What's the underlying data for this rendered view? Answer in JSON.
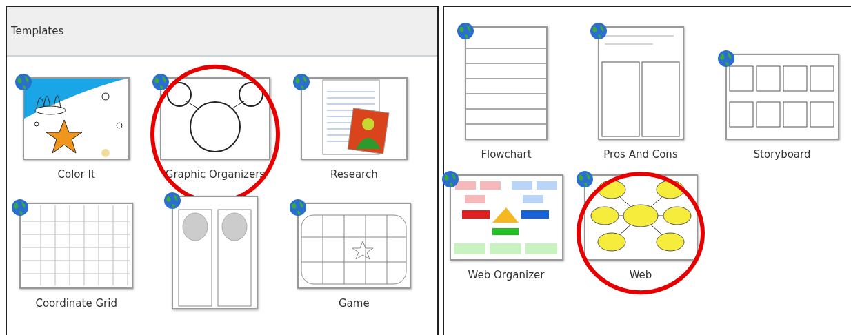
{
  "left_panel": {
    "header": "Templates",
    "templates": [
      {
        "kind": "coloring",
        "label": "Color It",
        "circled": false
      },
      {
        "kind": "circles",
        "label": "Graphic Organizers",
        "circled": true
      },
      {
        "kind": "research",
        "label": "Research",
        "circled": false
      },
      {
        "kind": "grid",
        "label": "Coordinate Grid",
        "circled": false
      },
      {
        "kind": "columns",
        "circled": false
      },
      {
        "kind": "board",
        "label": "Game",
        "circled": false
      }
    ]
  },
  "right_panel": {
    "templates": [
      {
        "kind": "flowchart",
        "label": "Flowchart",
        "circled": false
      },
      {
        "kind": "pros-cons",
        "label": "Pros And Cons",
        "circled": false
      },
      {
        "kind": "storyboard",
        "label": "Storyboard",
        "circled": false
      },
      {
        "kind": "web-organizer",
        "label": "Web Organizer",
        "circled": false
      },
      {
        "kind": "web",
        "label": "Web",
        "circled": true
      }
    ]
  }
}
